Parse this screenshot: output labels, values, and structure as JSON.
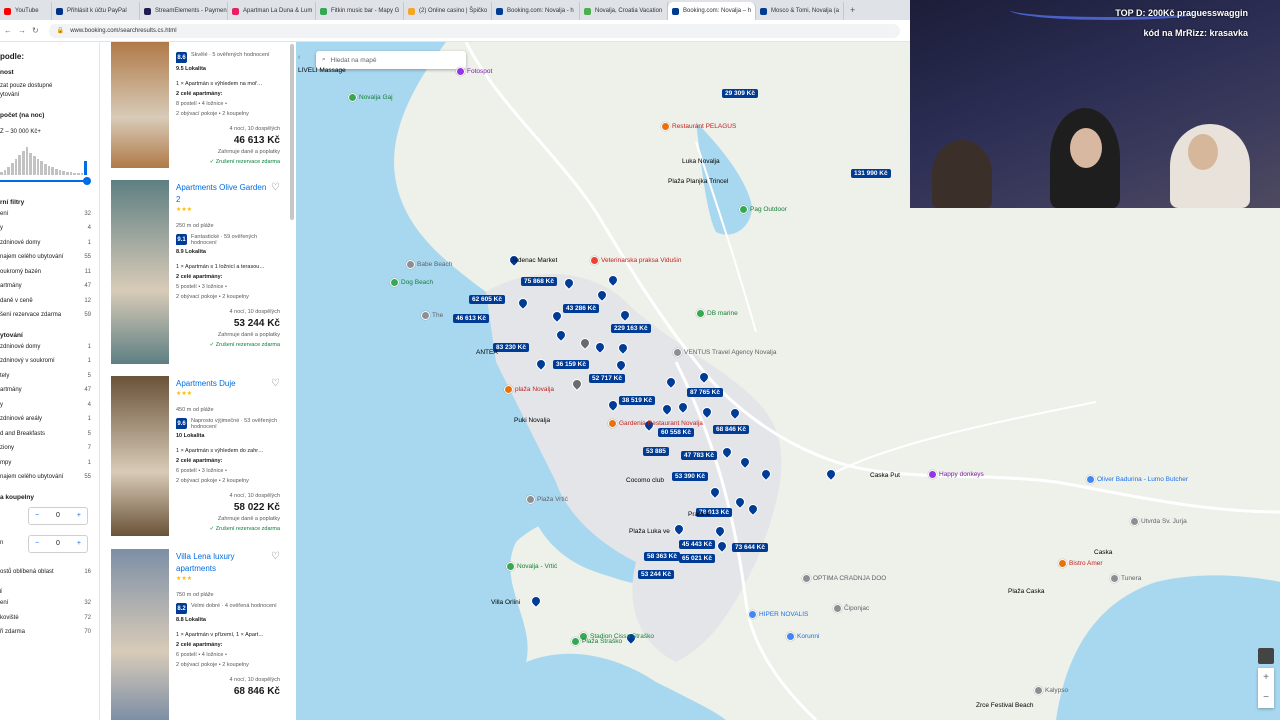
{
  "tabs": [
    {
      "label": "YouTube",
      "color": "#ff0000"
    },
    {
      "label": "Přihlásit k účtu PayPal",
      "color": "#003087"
    },
    {
      "label": "StreamElements - Paymen",
      "color": "#1f1f4f"
    },
    {
      "label": "Apartman La Duna & Lum",
      "color": "#e91e63"
    },
    {
      "label": "Fitkin music bar - Mapy G",
      "color": "#34a853"
    },
    {
      "label": "(2) Online casino | Špičko",
      "color": "#f5a623"
    },
    {
      "label": "Booking.com: Novalja - h",
      "color": "#003b95"
    },
    {
      "label": "Novalja, Croatia Vacation",
      "color": "#4caf50"
    },
    {
      "label": "Booking.com: Novalja – h",
      "color": "#003b95",
      "active": true
    },
    {
      "label": "Mosco & Tomi, Novalja (a",
      "color": "#003b95"
    }
  ],
  "address": {
    "url": "www.booking.com/searchresults.cs.html"
  },
  "filters": {
    "title": "podle:",
    "availability": {
      "heading": "nost",
      "items": [
        "zat pouze dostupné",
        "ytování"
      ]
    },
    "budget": {
      "heading": "počet (na noc)",
      "range": "Z – 30 000 Kč+",
      "histogram": [
        3,
        5,
        8,
        12,
        16,
        20,
        24,
        28,
        22,
        19,
        16,
        14,
        11,
        9,
        8,
        6,
        5,
        4,
        3,
        3,
        2,
        2,
        2,
        14
      ]
    },
    "popular": {
      "heading": "rní filtry",
      "items": [
        {
          "label": "ení",
          "count": "32"
        },
        {
          "label": "y",
          "count": "4"
        },
        {
          "label": "zdninové domy",
          "count": "1"
        },
        {
          "label": "najem celého ubytování",
          "count": "55"
        },
        {
          "label": "oukromý bazén",
          "count": "11"
        },
        {
          "label": "artmány",
          "count": "47"
        },
        {
          "label": "daně v ceně",
          "count": "12"
        },
        {
          "label": "šení rezervace zdarma",
          "count": "59"
        }
      ]
    },
    "type": {
      "heading": "ytování",
      "items": [
        {
          "label": "zdninové domy",
          "count": "1"
        },
        {
          "label": "zdninový v soukromí",
          "count": "1"
        },
        {
          "label": "tely",
          "count": "5"
        },
        {
          "label": "artmány",
          "count": "47"
        },
        {
          "label": "y",
          "count": "4"
        },
        {
          "label": "zdninové areály",
          "count": "1"
        },
        {
          "label": "d and Breakfasts",
          "count": "5"
        },
        {
          "label": "ziony",
          "count": "7"
        },
        {
          "label": "mpy",
          "count": "1"
        },
        {
          "label": "najem celého ubytování",
          "count": "55"
        }
      ]
    },
    "rooms": {
      "heading": "a koupelny",
      "bedrooms": "0",
      "bathrooms": "0",
      "minus": "−",
      "plus": "+",
      "row1": "",
      "row2": "n"
    },
    "area": {
      "label": "ostů oblíbená oblast",
      "count": "16"
    },
    "facilities": {
      "heading": "í",
      "items": [
        {
          "label": "ení",
          "count": "32"
        },
        {
          "label": "kovištė",
          "count": "72"
        },
        {
          "label": "ři zdarma",
          "count": "70"
        }
      ]
    }
  },
  "listings": [
    {
      "name": "",
      "stars": "",
      "distance": "",
      "score": "8.6",
      "score_text": "Skvělé · 5 ověřených hodnocení",
      "location": "9.5 Lokalita",
      "unit": "1 × Apartmán s výhledem na moř…",
      "apts": "2 celé apartmány:",
      "beds": "8 postelí • 4 ložnice •",
      "rooms": "2 obývací pokoje • 2 koupelny",
      "nights": "4 nocí, 10 dospělých",
      "price": "46 613 Kč",
      "fees": "Zahrnuje daně a poplatky",
      "free": "✓ Zrušení rezervace zdarma",
      "photo_color": "#b07a48"
    },
    {
      "name": "Apartments Olive Garden 2",
      "stars": "★★★",
      "distance": "250 m od pláže",
      "score": "9.1",
      "score_text": "Fantastické · 59 ověřených hodnocení",
      "location": "8.9 Lokalita",
      "unit": "1 × Apartmán s 1 ložnicí a terasou…",
      "apts": "2 celé apartmány:",
      "beds": "5 postelí • 3 ložnice •",
      "rooms": "2 obývací pokoje • 2 koupelny",
      "nights": "4 nocí, 10 dospělých",
      "price": "53 244 Kč",
      "fees": "Zahrnuje daně a poplatky",
      "free": "✓ Zrušení rezervace zdarma",
      "photo_color": "#5e7f82"
    },
    {
      "name": "Apartments Duje",
      "stars": "★★★",
      "distance": "450 m od pláže",
      "score": "9.6",
      "score_text": "Naprosto výjimečné · 53 ověřených hodnocení",
      "location": "10 Lokalita",
      "unit": "1 × Apartmán s výhledem do zahr…",
      "apts": "2 celé apartmány:",
      "beds": "6 postelí • 3 ložnice •",
      "rooms": "2 obývací pokoje • 2 koupelny",
      "nights": "4 nocí, 10 dospělých",
      "price": "58 022 Kč",
      "fees": "Zahrnuje daně a poplatky",
      "free": "✓ Zrušení rezervace zdarma",
      "photo_color": "#6a5338"
    },
    {
      "name": "Villa Lena luxury apartments",
      "stars": "★★★",
      "distance": "750 m od pláže",
      "score": "8.2",
      "score_text": "Velmi dobré · 4 ověřená hodnocení",
      "location": "8.8 Lokalita",
      "unit": "1 × Apartmán v přízemí, 1 × Apart…",
      "apts": "2 celé apartmány:",
      "beds": "6 postelí • 4 ložnice •",
      "rooms": "2 obývací pokoje • 2 koupelny",
      "nights": "4 nocí, 10 dospělých",
      "price": "68 846 Kč",
      "fees": "",
      "free": "",
      "photo_color": "#7d8fa6"
    }
  ],
  "map": {
    "search_placeholder": "Hledat na mapě",
    "price_labels": [
      "29 309 Kč",
      "131 990 Kč",
      "75 868 Kč",
      "62 605 Kč",
      "43 286 Kč",
      "46 613 Kč",
      "229 163 Kč",
      "83 230 Kč",
      "36 159 Kč",
      "52 717 Kč",
      "87 765 Kč",
      "38 519 Kč",
      "68 846 Kč",
      "60 558 Kč",
      "53 885",
      "47 783 Kč",
      "53 390 Kč",
      "78 013 Kč",
      "45 443 Kč",
      "73 644 Kč",
      "65 021 Kč",
      "58 363 Kč",
      "53 244 Kč"
    ],
    "pois": [
      {
        "label": "Fotospot",
        "kind": "purple"
      },
      {
        "label": "LIVELI Massage",
        "kind": "plain"
      },
      {
        "label": "Novalja Gaj",
        "kind": "green"
      },
      {
        "label": "Restaurant PELAGUS",
        "kind": "orange"
      },
      {
        "label": "Luka Novalja",
        "kind": "plain"
      },
      {
        "label": "Plaža Planjka Trincel",
        "kind": "plain"
      },
      {
        "label": "Pag Outdoor",
        "kind": "green"
      },
      {
        "label": "Babe Beach",
        "kind": "gray"
      },
      {
        "label": "Dog Beach",
        "kind": "green"
      },
      {
        "label": "Jadenac Market",
        "kind": "plain"
      },
      {
        "label": "Veterinarska praksa Vidušin",
        "kind": "red"
      },
      {
        "label": "The",
        "kind": "gray"
      },
      {
        "label": "DB marine",
        "kind": "green"
      },
      {
        "label": "VENTUS Travel Agency Novalja",
        "kind": "gray"
      },
      {
        "label": "ANTEA",
        "kind": "plain"
      },
      {
        "label": "plaža Novalja",
        "kind": "orange"
      },
      {
        "label": "Puki Novalja",
        "kind": "plain"
      },
      {
        "label": "Gardenia Restaurant Novalja",
        "kind": "orange"
      },
      {
        "label": "Cocomo club",
        "kind": "plain"
      },
      {
        "label": "Plaža Vrtić",
        "kind": "gray"
      },
      {
        "label": "Pradine",
        "kind": "plain"
      },
      {
        "label": "Plaža Luka ve",
        "kind": "plain"
      },
      {
        "label": "Happy donkeys",
        "kind": "purple"
      },
      {
        "label": "Oliver Badurina - Lumo Butcher",
        "kind": "blue"
      },
      {
        "label": "Utvrda Sv. Jurja",
        "kind": "gray"
      },
      {
        "label": "Caska",
        "kind": "plain"
      },
      {
        "label": "Bistro Amer",
        "kind": "orange"
      },
      {
        "label": "Plaža Caska",
        "kind": "plain"
      },
      {
        "label": "Tunera",
        "kind": "gray"
      },
      {
        "label": "OPTIMA CRADNJA DOO",
        "kind": "gray"
      },
      {
        "label": "Čiponjac",
        "kind": "gray"
      },
      {
        "label": "HIPER NOVALIS",
        "kind": "blue"
      },
      {
        "label": "Korunni",
        "kind": "blue"
      },
      {
        "label": "Novalja - Vrtić",
        "kind": "green"
      },
      {
        "label": "Villa Orlini",
        "kind": "plain"
      },
      {
        "label": "Stadion Cissa Straško",
        "kind": "green"
      },
      {
        "label": "Plaža Straško",
        "kind": "green"
      },
      {
        "label": "Kalypso",
        "kind": "gray"
      },
      {
        "label": "Zrce Festival Beach",
        "kind": "plain"
      },
      {
        "label": "Caska Put",
        "kind": "plain"
      }
    ]
  },
  "webcam": {
    "line1": "TOP D: 200Kč praguesswaggin",
    "line2": "kód na MrRizz: krasavka"
  },
  "colors": {
    "brand": "#003b95",
    "link": "#006ce4",
    "water": "#a8d8f0",
    "land": "#eef0ea",
    "urban": "#e6e6e8"
  }
}
